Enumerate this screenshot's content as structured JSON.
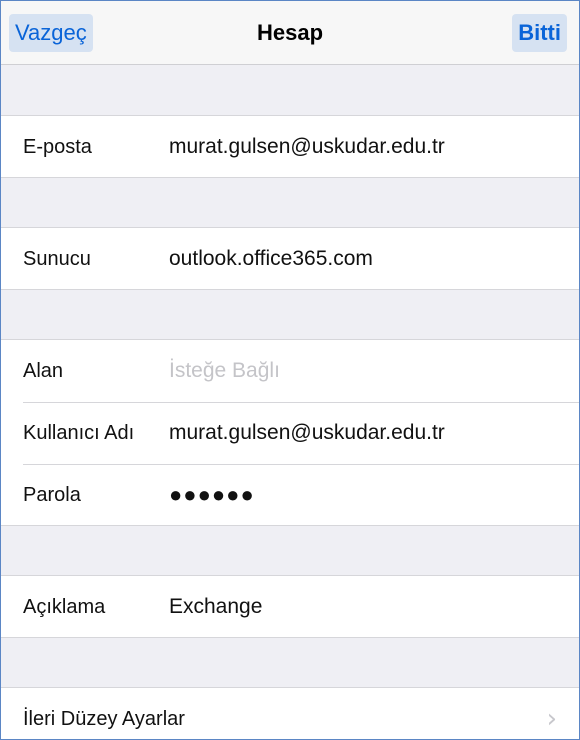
{
  "nav": {
    "cancel_label": "Vazgeç",
    "title": "Hesap",
    "done_label": "Bitti"
  },
  "fields": {
    "email": {
      "label": "E-posta",
      "value": "murat.gulsen@uskudar.edu.tr"
    },
    "server": {
      "label": "Sunucu",
      "value": "outlook.office365.com"
    },
    "domain": {
      "label": "Alan",
      "placeholder": "İsteğe Bağlı"
    },
    "username": {
      "label": "Kullanıcı Adı",
      "value": "murat.gulsen@uskudar.edu.tr"
    },
    "password": {
      "label": "Parola",
      "value": "●●●●●●"
    },
    "description": {
      "label": "Açıklama",
      "value": "Exchange"
    },
    "advanced": {
      "label": "İleri Düzey Ayarlar",
      "chevron": "›"
    }
  },
  "colors": {
    "accent": "#0a64d8",
    "background": "#efeff4",
    "placeholder": "#c4c4c8"
  },
  "icons": {
    "advanced_chevron": "chevron-right-icon"
  }
}
